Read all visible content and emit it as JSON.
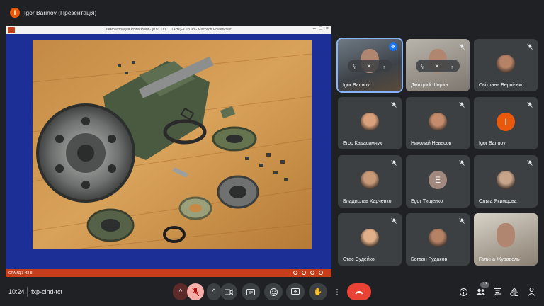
{
  "top": {
    "avatar_letter": "I",
    "title": "Igor Barinov (Презентація)"
  },
  "ppt": {
    "window_title": "Демонстрация PowerPoint - [РУС ГОСТ ТАНДЕК 13.93 - Microsoft PowerPoint",
    "status": "СЛАЙД 3 ИЗ 8"
  },
  "tiles": [
    {
      "name": "Igor Barinov",
      "kind": "video"
    },
    {
      "name": "Дмитрий Ширин",
      "kind": "video"
    },
    {
      "name": "Світлана Верлієнко",
      "kind": "photo"
    },
    {
      "name": "Егор Кадасимчук",
      "kind": "photo"
    },
    {
      "name": "Николай Невесов",
      "kind": "photo"
    },
    {
      "name": "Igor Barinov",
      "kind": "letter",
      "letter": "I"
    },
    {
      "name": "Владислав Харченко",
      "kind": "photo"
    },
    {
      "name": "Egor Тищенко",
      "kind": "letter",
      "letter": "E"
    },
    {
      "name": "Ольга Якимцова",
      "kind": "photo"
    },
    {
      "name": "Стас Судейко",
      "kind": "photo"
    },
    {
      "name": "Богдан Рудаков",
      "kind": "photo"
    },
    {
      "name": "Галина Журавель",
      "kind": "video"
    }
  ],
  "bottom": {
    "time": "10:24",
    "meeting_code": "fxp-cihd-tct",
    "participants_count": "13"
  },
  "colors": {
    "accent": "#8ab4f8",
    "end_call": "#ea4335",
    "ppt_red": "#c43e1c",
    "slide_blue": "#1c2f96"
  }
}
